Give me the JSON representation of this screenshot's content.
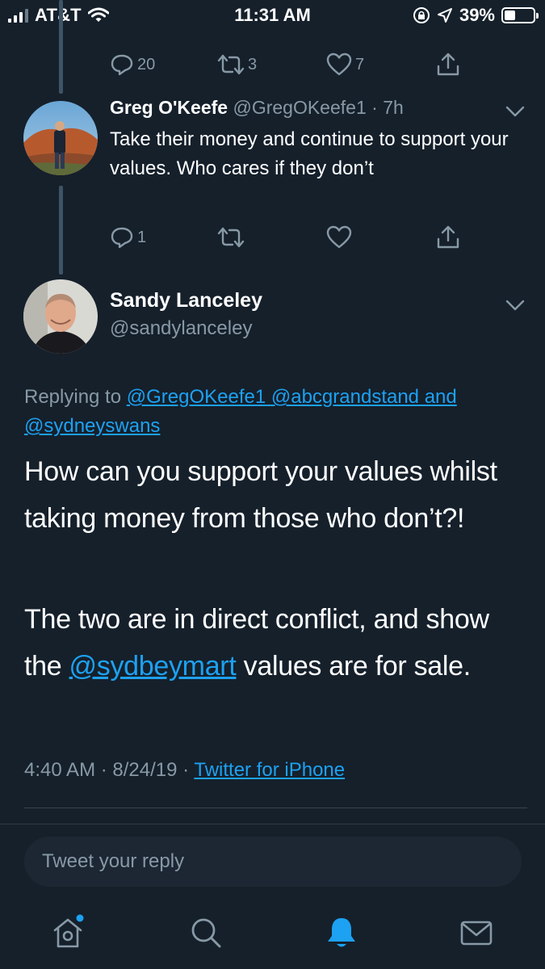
{
  "status_bar": {
    "carrier": "AT&T",
    "time": "11:31 AM",
    "battery": "39%",
    "battery_level": 0.39
  },
  "prev_actions": {
    "replies": "20",
    "retweets": "3",
    "likes": "7"
  },
  "tweet1": {
    "name": "Greg O'Keefe",
    "handle": "@GregOKeefe1",
    "time": "· 7h",
    "text": "Take their money and continue to support your values. Who cares if they don’t",
    "replies": "1"
  },
  "main_tweet": {
    "name": "Sandy Lanceley",
    "handle": "@sandylanceley",
    "replying_prefix": "Replying to",
    "replying_to": "@GregOKeefe1 @abcgrandstand and @sydneyswans",
    "paragraph1": "How can you support your values whilst taking money from those who don’t?!",
    "paragraph2_before": "The two are in direct conflict, and show the",
    "paragraph2_mention": "@sydbeymart",
    "paragraph2_after": "values are for sale.",
    "timestamp": "4:40 AM · 8/24/19 ·",
    "source": "Twitter for iPhone"
  },
  "reply_box": {
    "placeholder": "Tweet your reply"
  },
  "colors": {
    "background": "#15202b",
    "accent": "#1da1f2",
    "muted": "#8899a6"
  }
}
